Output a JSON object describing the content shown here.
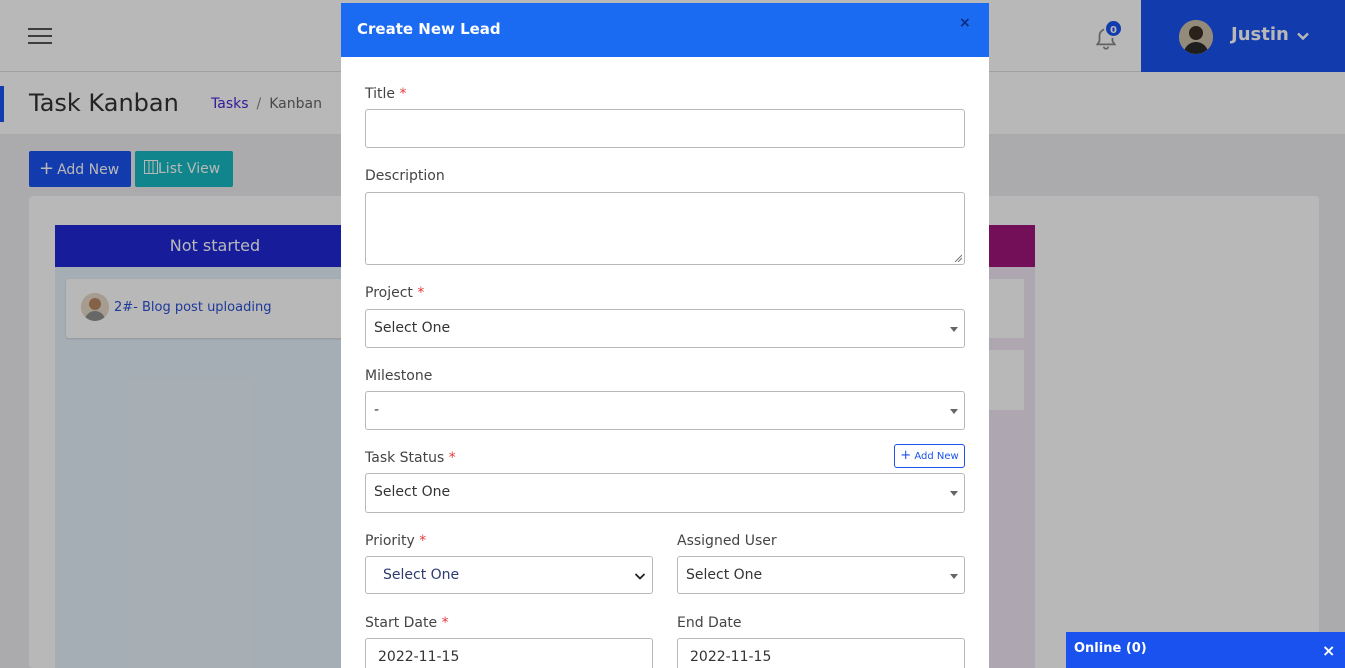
{
  "header": {
    "notification_count": "0",
    "user_name": "Justin"
  },
  "page": {
    "title": "Task Kanban",
    "breadcrumb": [
      "Tasks",
      "Kanban"
    ],
    "add_new_label": "Add New",
    "list_view_label": "List View"
  },
  "kanban": {
    "columns": [
      {
        "title": "Not started",
        "color": "#1f27d6"
      },
      {
        "title": "",
        "color": "#a0167a"
      }
    ],
    "cards": [
      {
        "title": "2#- Blog post uploading"
      }
    ]
  },
  "chat": {
    "label": "Online (0)",
    "close": "×"
  },
  "modal": {
    "title": "Create New Lead",
    "close": "×",
    "fields": {
      "title": {
        "label": "Title",
        "value": ""
      },
      "description": {
        "label": "Description",
        "value": ""
      },
      "project": {
        "label": "Project",
        "value": "Select One"
      },
      "milestone": {
        "label": "Milestone",
        "value": "-"
      },
      "task_status": {
        "label": "Task Status",
        "value": "Select One",
        "add_new": "Add New"
      },
      "priority": {
        "label": "Priority",
        "value": "Select One"
      },
      "assigned_user": {
        "label": "Assigned User",
        "value": "Select One"
      },
      "start_date": {
        "label": "Start Date",
        "value": "2022-11-15"
      },
      "end_date": {
        "label": "End Date",
        "value": "2022-11-15"
      }
    },
    "required_mark": "*"
  },
  "colors": {
    "primary": "#1a52f0",
    "modal_header": "#1a6af2",
    "teal": "#18b9c2",
    "required": "#e53b3b"
  }
}
